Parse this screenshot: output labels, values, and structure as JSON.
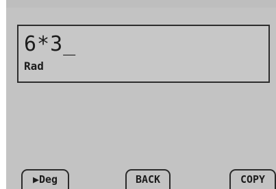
{
  "display": {
    "expression": "6*3_",
    "angle_mode": "Rad"
  },
  "softkeys": {
    "left": "▶Deg",
    "middle": "BACK",
    "right": "COPY"
  }
}
